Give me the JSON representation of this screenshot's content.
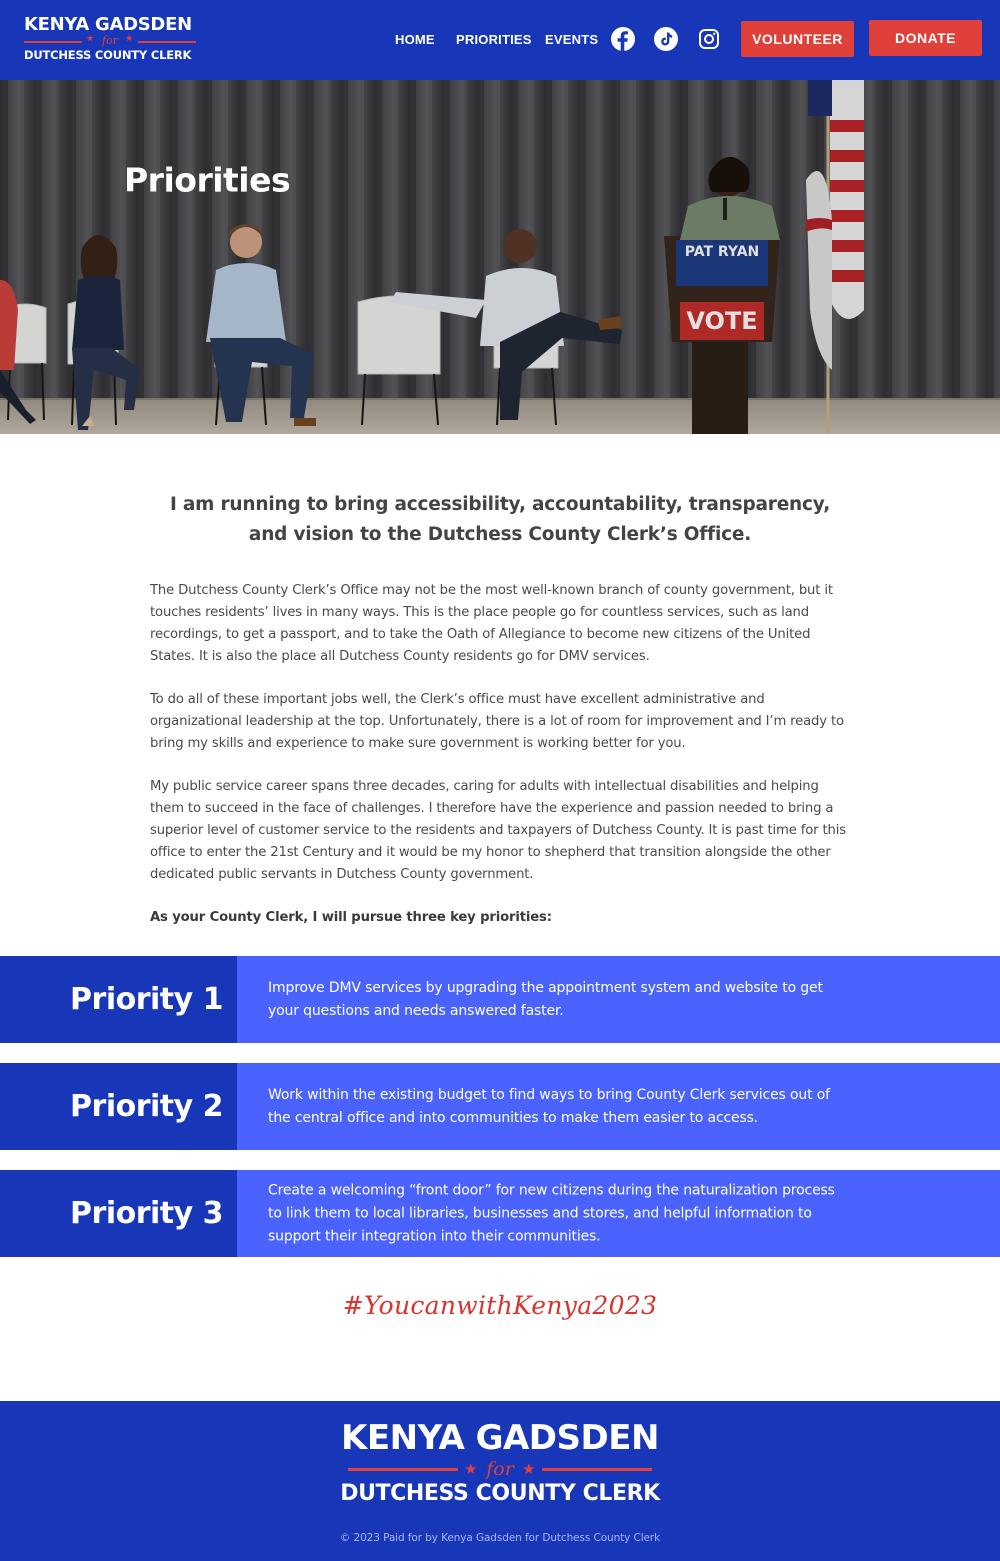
{
  "header": {
    "logo": {
      "name": "KENYA GADSDEN",
      "for": "for",
      "office": "DUTCHESS COUNTY CLERK"
    },
    "nav": [
      "HOME",
      "PRIORITIES",
      "EVENTS"
    ],
    "social_icons": [
      "facebook-icon",
      "tiktok-icon",
      "instagram-icon"
    ],
    "volunteer_label": "VOLUNTEER",
    "donate_label": "DONATE",
    "colors": {
      "brand_blue": "#1836b8",
      "accent_red": "#e0403a",
      "priority_blue": "#4a63ff"
    }
  },
  "hero": {
    "title": "Priorities",
    "podium_sign_name": "PAT RYAN",
    "podium_sign_vote": "VOTE"
  },
  "intro": {
    "heading": "I am running to bring accessibility, accountability, transparency, and vision to the Dutchess County Clerk’s Office.",
    "paragraphs": [
      "The Dutchess County Clerk’s Office may not be the most well-known branch of county government, but it touches residents’ lives in many ways. This is the place people go for countless services, such as land recordings, to get a passport, and to take the Oath of Allegiance to become new citizens of the United States. It is also the place all Dutchess County residents go for DMV services.",
      "To do all of these important jobs well, the Clerk’s office must have excellent administrative and organizational leadership at the top. Unfortunately, there is a lot of room for improvement and I’m ready to bring my skills and experience to make sure government is working better for you.",
      "My public service career spans three decades, caring for adults with intellectual disabilities and helping them to succeed in the face of challenges. I therefore have the experience and passion needed to bring a superior level of customer service to the residents and taxpayers of Dutchess County. It is past time for this office to enter the 21st Century and it would be my honor to shepherd that transition alongside the other dedicated public servants in Dutchess County government."
    ],
    "lead_in": "As your County Clerk, I will pursue three key priorities:"
  },
  "priorities": [
    {
      "label": "Priority 1",
      "text": "Improve DMV services by upgrading the appointment system and website to get your questions and needs answered faster."
    },
    {
      "label": "Priority 2",
      "text": "Work within the existing budget to find ways to bring County Clerk services out of the central office and into communities to make them easier to access."
    },
    {
      "label": "Priority 3",
      "text": "Create a welcoming “front door” for new citizens during the naturalization process to link them to local libraries, businesses and stores, and helpful information to support their integration into their communities."
    }
  ],
  "hashtag": "#YoucanwithKenya2023",
  "footer": {
    "logo": {
      "name": "KENYA GADSDEN",
      "for": "for",
      "office": "DUTCHESS COUNTY CLERK"
    },
    "copyright": "© 2023 Paid for by Kenya Gadsden for Dutchess County Clerk"
  }
}
